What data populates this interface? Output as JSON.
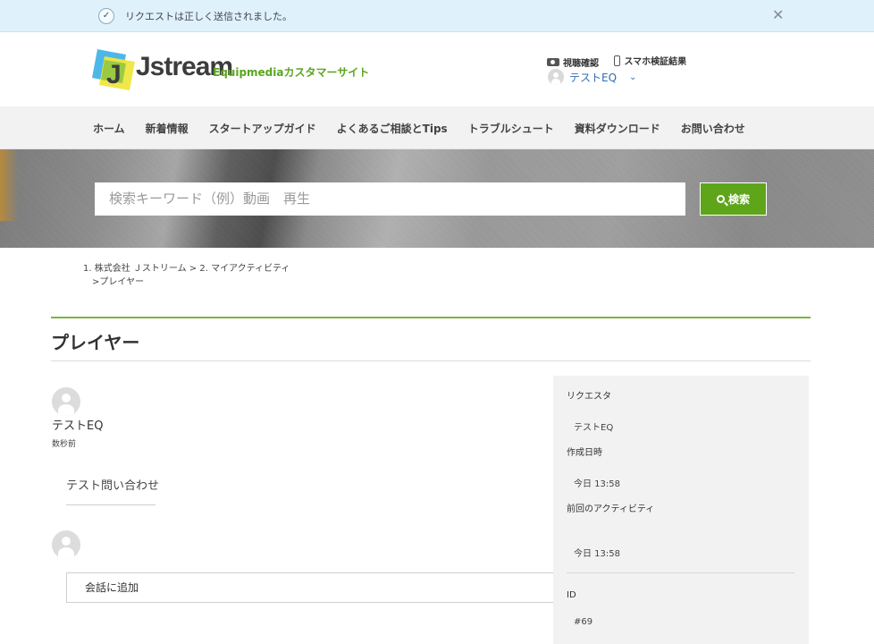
{
  "notice": {
    "message": "リクエストは正しく送信されました。"
  },
  "header": {
    "logo_text": "Jstream",
    "site_name": "Equipmediaカスタマーサイト",
    "links": [
      "視聴確認",
      "スマホ検証結果"
    ],
    "user_name": "テストEQ"
  },
  "nav": {
    "items": [
      "ホーム",
      "新着情報",
      "スタートアップガイド",
      "よくあるご相談とTips",
      "トラブルシュート",
      "資料ダウンロード",
      "お問い合わせ"
    ]
  },
  "search": {
    "placeholder": "検索キーワード（例）動画　再生",
    "button_label": "検索"
  },
  "breadcrumb": {
    "item1": "株式会社 Ｊストリーム",
    "item2": "マイアクティビティ",
    "item3": "プレイヤー"
  },
  "page": {
    "title": "プレイヤー"
  },
  "comment": {
    "author": "テストEQ",
    "time": "数秒前",
    "body": "テスト問い合わせ",
    "add_placeholder": "会話に追加"
  },
  "sidebar": {
    "requester_label": "リクエスタ",
    "requester_value": "テストEQ",
    "created_label": "作成日時",
    "created_value": "今日 13:58",
    "last_activity_label": "前回のアクティビティ",
    "last_activity_value": "今日 13:58",
    "id_label": "ID",
    "id_value": "#69"
  },
  "colors": {
    "accent_green": "#5ea51a",
    "link_blue": "#2e6fb2",
    "notice_bg": "#dff1fb"
  }
}
